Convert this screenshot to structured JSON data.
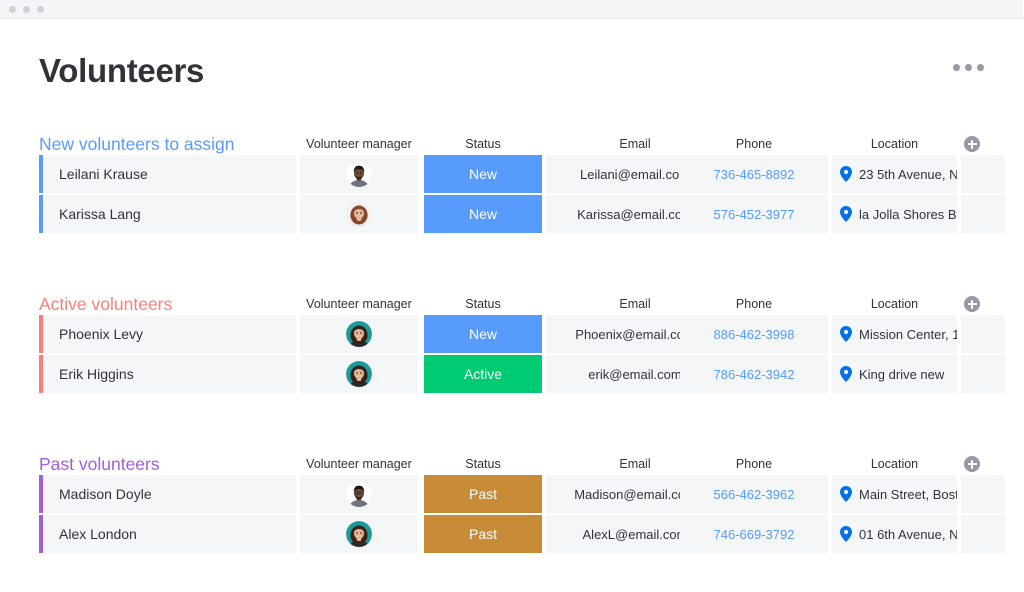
{
  "window": {
    "titlebar_dots": [
      "dot",
      "dot",
      "dot"
    ]
  },
  "header": {
    "title": "Volunteers",
    "more_menu_label": "..."
  },
  "columns": {
    "name": "",
    "manager": "Volunteer manager",
    "status": "Status",
    "email": "Email",
    "phone": "Phone",
    "location": "Location",
    "add_column": "+"
  },
  "colors": {
    "group_new": "#579bfc",
    "group_active": "#fb7f79",
    "group_past": "#a25ddc",
    "status_new": "#579bfc",
    "status_active": "#00ca72",
    "status_past": "#c98c36",
    "link": "#579bfc",
    "text": "#323338",
    "cell_bg": "#f5f6f8"
  },
  "groups": [
    {
      "title": "New volunteers to assign",
      "color": "#579bfc",
      "rows": [
        {
          "name": "Leilani Krause",
          "manager_avatar": "avatar-man-dark",
          "status": "New",
          "status_color": "#579bfc",
          "email": "Leilani@email.com",
          "phone": "736-465-8892",
          "location": "23 5th Avenue, N"
        },
        {
          "name": "Karissa Lang",
          "manager_avatar": "avatar-woman-brown-hair",
          "status": "New",
          "status_color": "#579bfc",
          "email": "Karissa@email.com",
          "phone": "576-452-3977",
          "location": "la Jolla Shores B"
        }
      ]
    },
    {
      "title": "Active volunteers",
      "color": "#fb7f79",
      "rows": [
        {
          "name": "Phoenix Levy",
          "manager_avatar": "avatar-woman-teal",
          "status": "New",
          "status_color": "#579bfc",
          "email": "Phoenix@email.com",
          "phone": "886-462-3998",
          "location": "Mission Center, 1"
        },
        {
          "name": "Erik Higgins",
          "manager_avatar": "avatar-woman-teal",
          "status": "Active",
          "status_color": "#00ca72",
          "email": "erik@email.com",
          "phone": "786-462-3942",
          "location": "King drive new"
        }
      ]
    },
    {
      "title": "Past volunteers",
      "color": "#a25ddc",
      "rows": [
        {
          "name": "Madison Doyle",
          "manager_avatar": "avatar-man-glasses",
          "status": "Past",
          "status_color": "#c98c36",
          "email": "Madison@email.com",
          "phone": "566-462-3962",
          "location": "Main Street, Bost"
        },
        {
          "name": "Alex London",
          "manager_avatar": "avatar-woman-teal-2",
          "status": "Past",
          "status_color": "#c98c36",
          "email": "AlexL@email.com",
          "phone": "746-669-3792",
          "location": "01 6th Avenue, N"
        }
      ]
    }
  ],
  "layout": {
    "group_tops": [
      114,
      274,
      434
    ]
  }
}
